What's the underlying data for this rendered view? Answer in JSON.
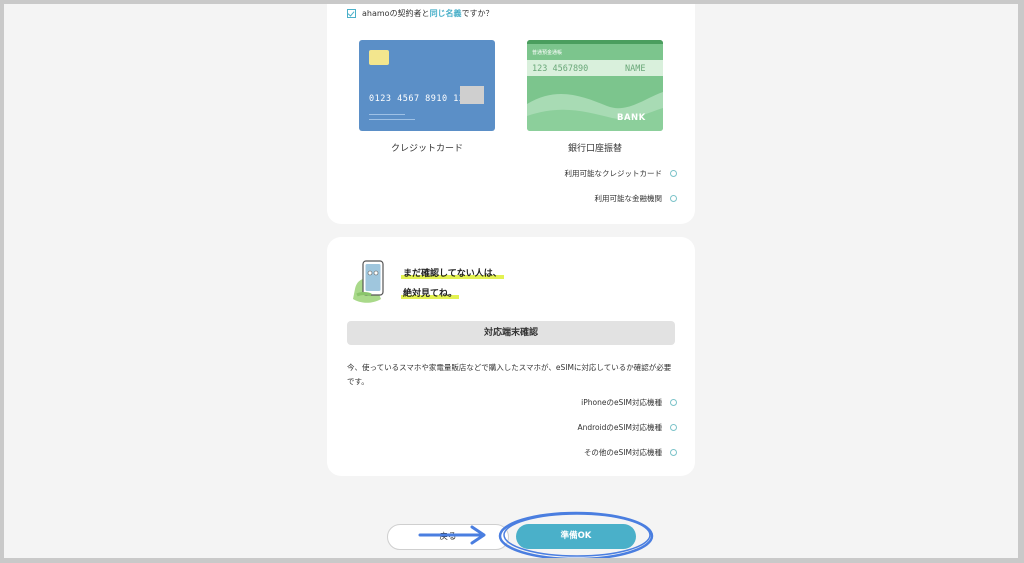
{
  "card1": {
    "question_prefix": "ahamoの契約者と",
    "question_highlight": "同じ名義",
    "question_suffix": "ですか？",
    "credit_card": {
      "number": "0123 4567 8910 1234",
      "caption": "クレジットカード"
    },
    "bank": {
      "header": "普通預金通帳",
      "account": "123 4567890",
      "name": "NAME",
      "label": "BANK",
      "caption": "銀行口座振替"
    },
    "links": [
      "利用可能なクレジットカード",
      "利用可能な金融機関"
    ]
  },
  "card2": {
    "headline1": "まだ確認してない人は、",
    "headline2": "絶対見てね。",
    "button_label": "対応端末確認",
    "description": "今、使っているスマホや家電量販店などで購入したスマホが、eSIMに対応しているか確認が必要です。",
    "links": [
      "iPhoneのeSIM対応機種",
      "AndroidのeSIM対応機種",
      "その他のeSIM対応機種"
    ]
  },
  "footer": {
    "back_label": "戻る",
    "ok_label": "準備OK"
  },
  "colors": {
    "accent": "#4ab0c9",
    "highlight": "#e3f252",
    "annotation": "#4a7ee0"
  }
}
